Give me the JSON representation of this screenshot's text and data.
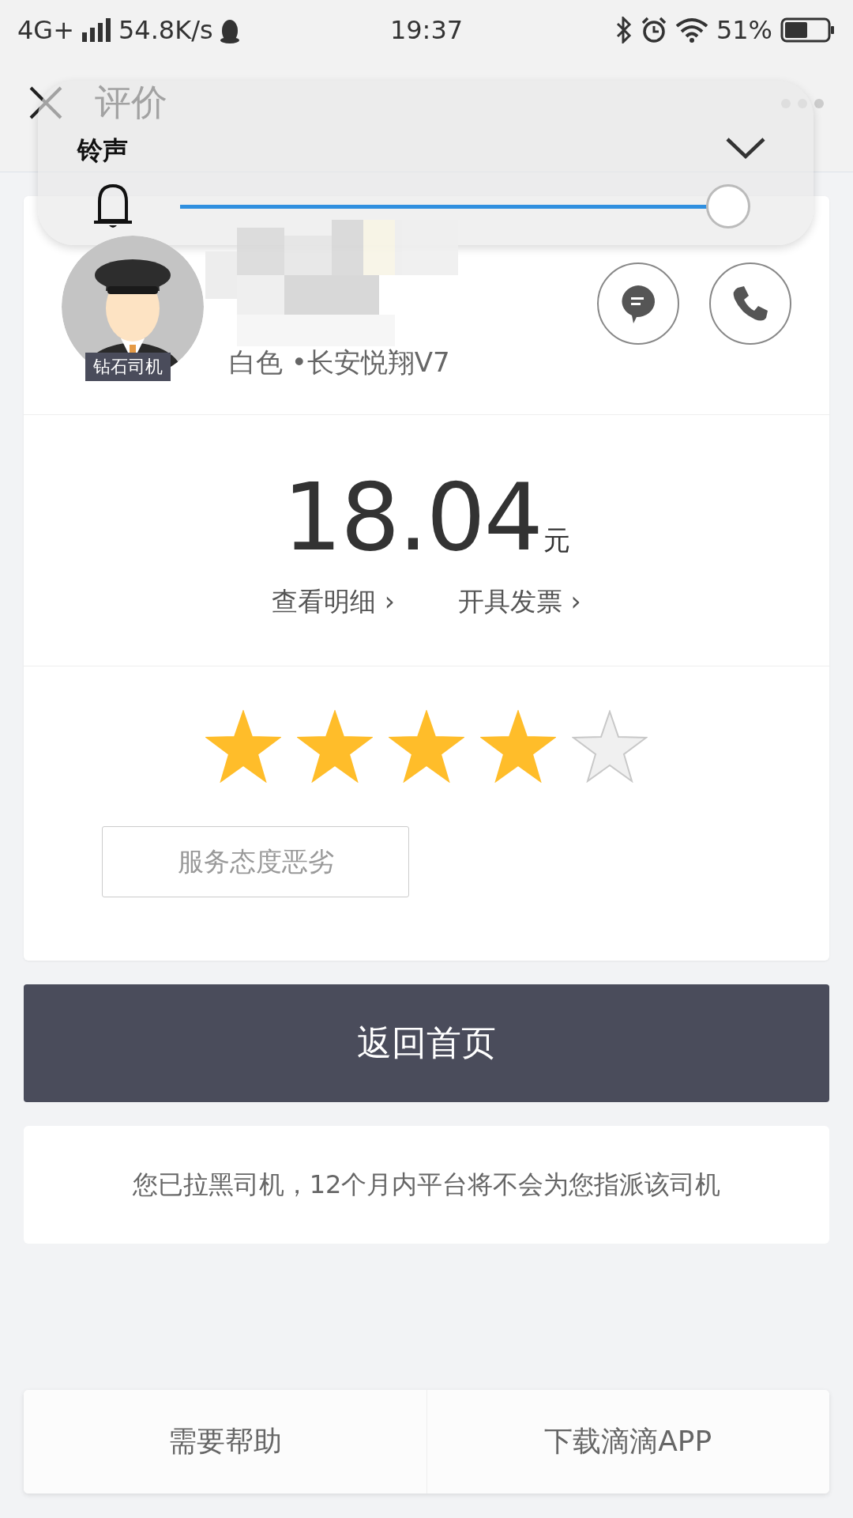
{
  "status_bar": {
    "network": "4G+",
    "speed": "54.8K/s",
    "time": "19:37",
    "battery": "51%"
  },
  "header": {
    "title": "评价"
  },
  "volume_panel": {
    "label": "铃声",
    "level": 1.0
  },
  "driver": {
    "badge": "钻石司机",
    "car": "白色 •长安悦翔V7"
  },
  "fare": {
    "amount": "18.04",
    "unit": "元",
    "links": [
      "查看明细 ›",
      "开具发票 ›"
    ]
  },
  "rating": {
    "stars": 4,
    "tags": [
      "服务态度恶劣"
    ]
  },
  "primary_button": "返回首页",
  "notice": "您已拉黑司机，12个月内平台将不会为您指派该司机",
  "bottom_actions": [
    "需要帮助",
    "下载滴滴APP"
  ]
}
